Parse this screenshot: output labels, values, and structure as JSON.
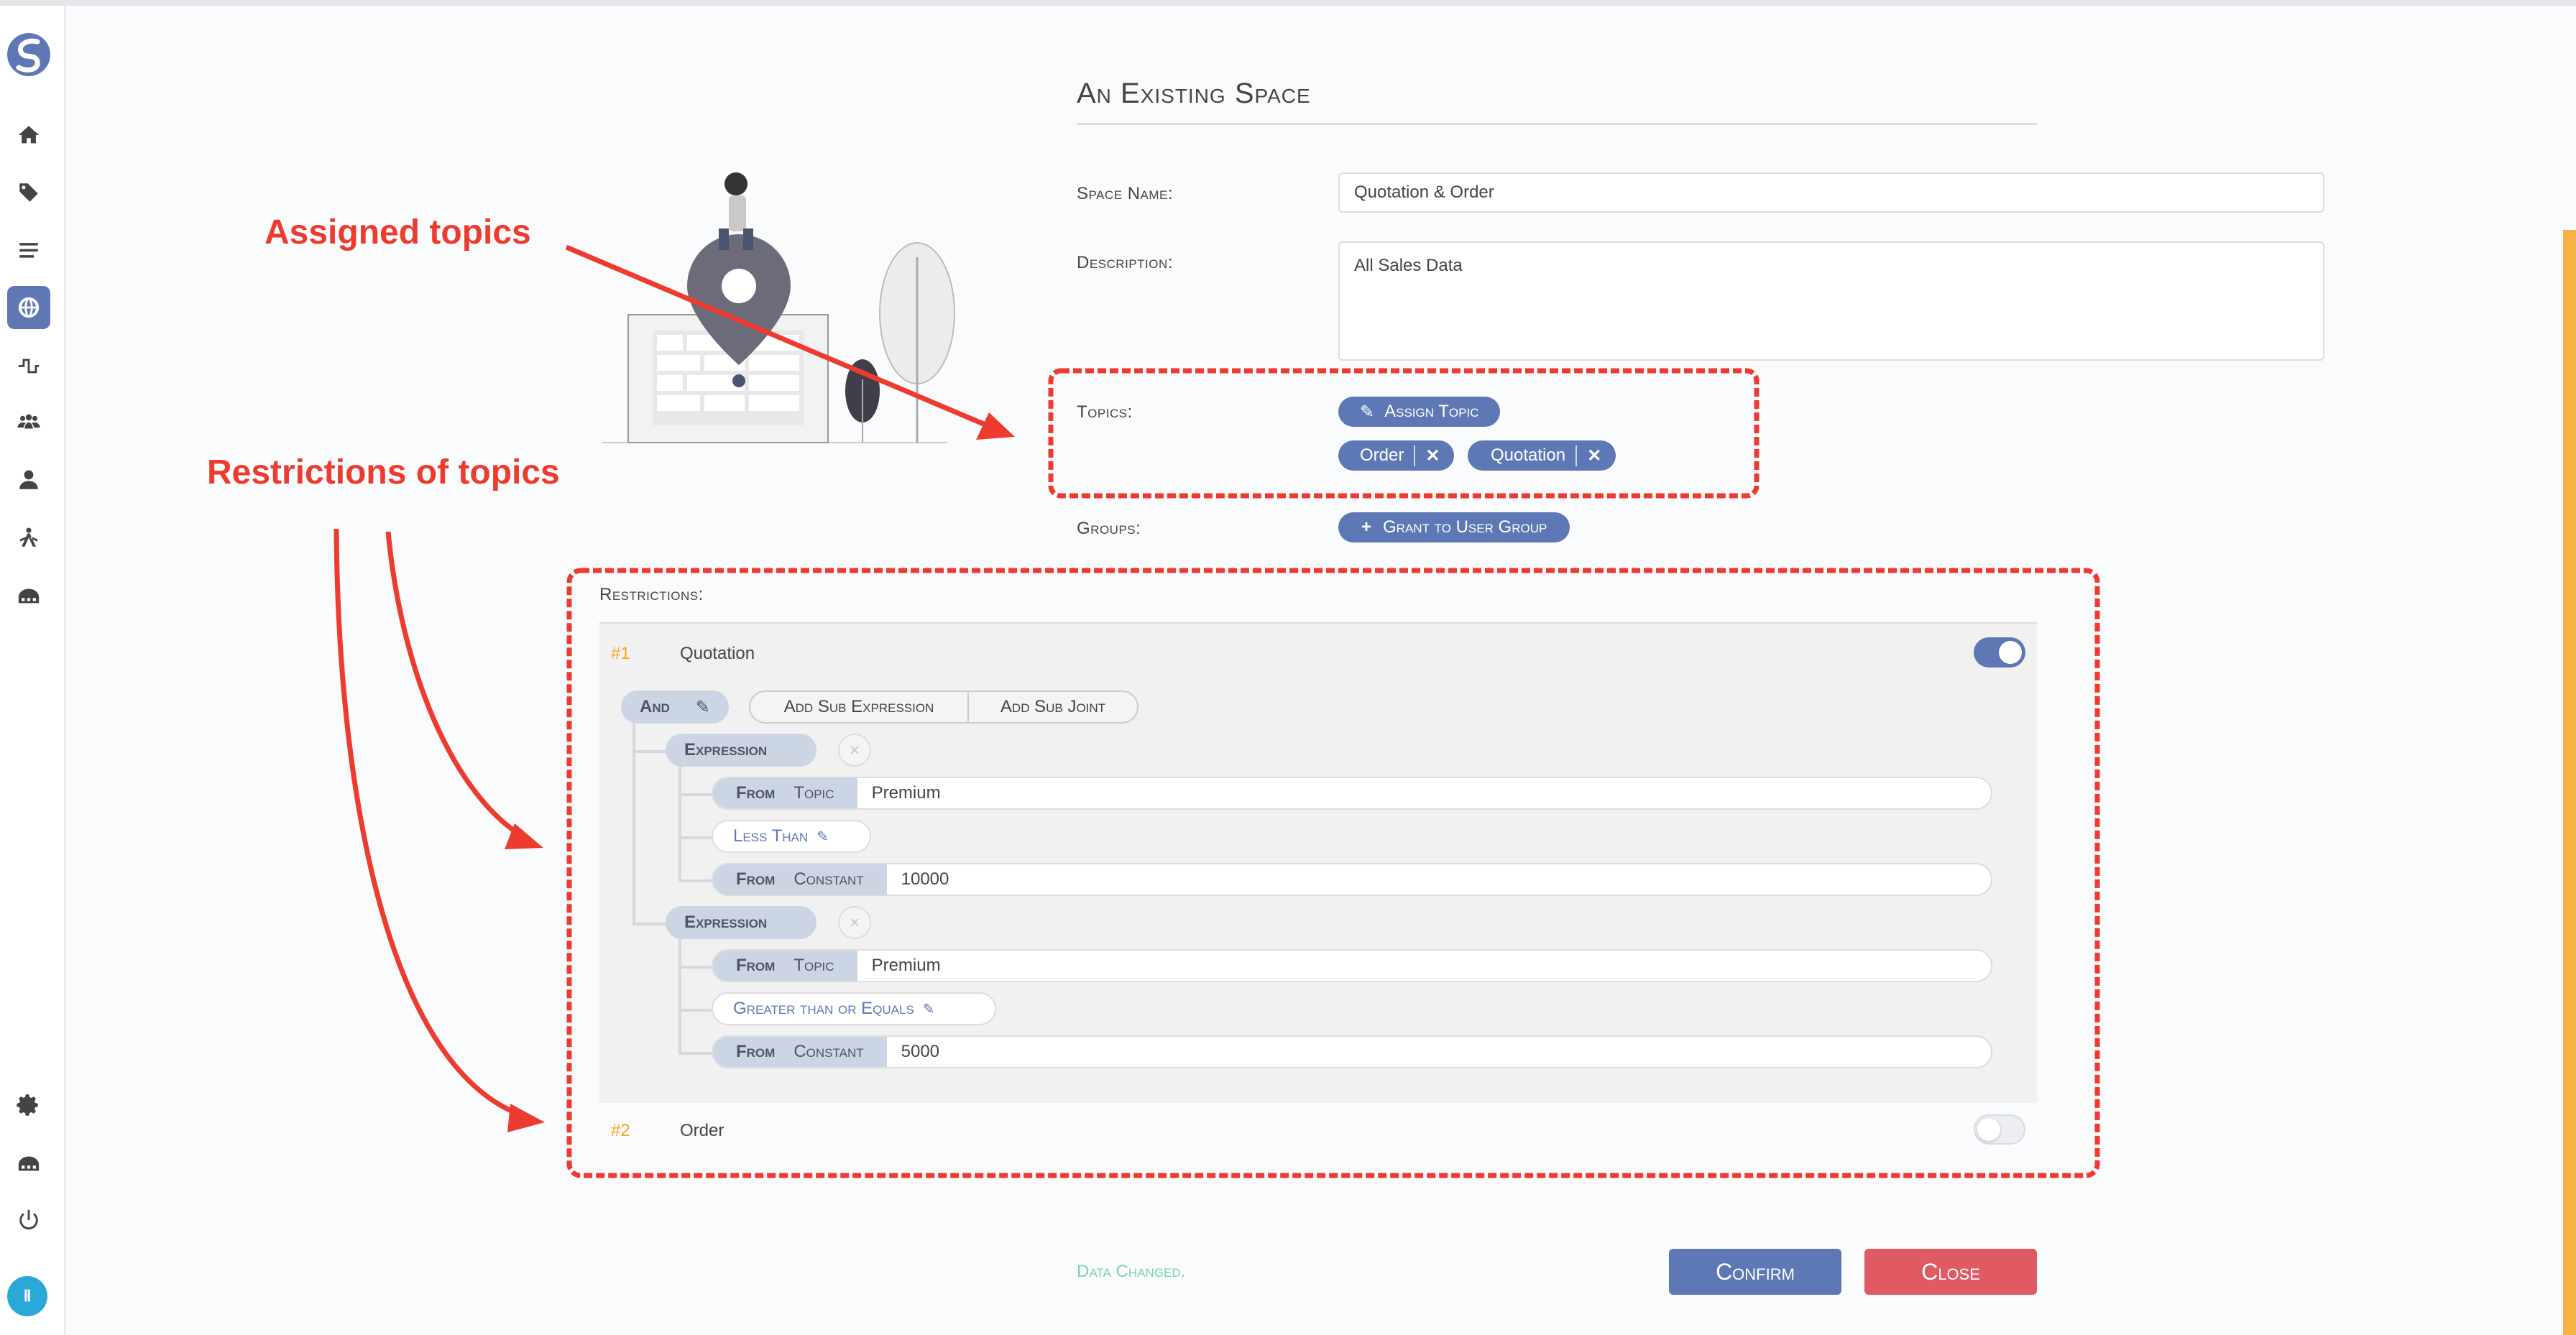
{
  "dialog": {
    "title": "An Existing Space",
    "space_name_label": "Space Name:",
    "space_name_value": "Quotation & Order",
    "description_label": "Description:",
    "description_value": "All Sales Data",
    "topics_label": "Topics:",
    "assign_topic_label": "Assign Topic",
    "topics": [
      "Order",
      "Quotation"
    ],
    "remove_glyph": "✕",
    "groups_label": "Groups:",
    "grant_label": "Grant to User Group",
    "restrictions_label": "Restrictions:"
  },
  "restrictions": [
    {
      "index": "#1",
      "topic": "Quotation",
      "enabled": true,
      "joint": "And",
      "add_sub_expression": "Add Sub Expression",
      "add_sub_joint": "Add Sub Joint",
      "expressions": [
        {
          "label": "Expression",
          "left": {
            "from": "From",
            "kind": "Topic",
            "value": "Premium"
          },
          "operator": "Less Than",
          "right": {
            "from": "From",
            "kind": "Constant",
            "value": "10000"
          }
        },
        {
          "label": "Expression",
          "left": {
            "from": "From",
            "kind": "Topic",
            "value": "Premium"
          },
          "operator": "Greater than or Equals",
          "right": {
            "from": "From",
            "kind": "Constant",
            "value": "5000"
          }
        }
      ]
    },
    {
      "index": "#2",
      "topic": "Order",
      "enabled": false
    }
  ],
  "footer": {
    "status": "Data Changed.",
    "confirm_label": "Confirm",
    "close_label": "Close"
  },
  "annotations": {
    "assigned_topics": "Assigned topics",
    "restrictions_of_topics": "Restrictions of topics"
  },
  "avatar_initials": "Ⅱ",
  "colors": {
    "accent": "#5d78b4",
    "close": "#e05a64",
    "status": "#7ed3a6",
    "annotation": "#ee3b2f",
    "index": "#f5a623"
  },
  "icons": {
    "sidebar": [
      "logo-icon",
      "home-icon",
      "tags-icon",
      "menu-icon",
      "globe-icon",
      "pipeline-icon",
      "users-icon",
      "user-icon",
      "console-icon",
      "igloo-icon",
      "gear-icon",
      "user-groups-icon",
      "power-icon"
    ]
  }
}
